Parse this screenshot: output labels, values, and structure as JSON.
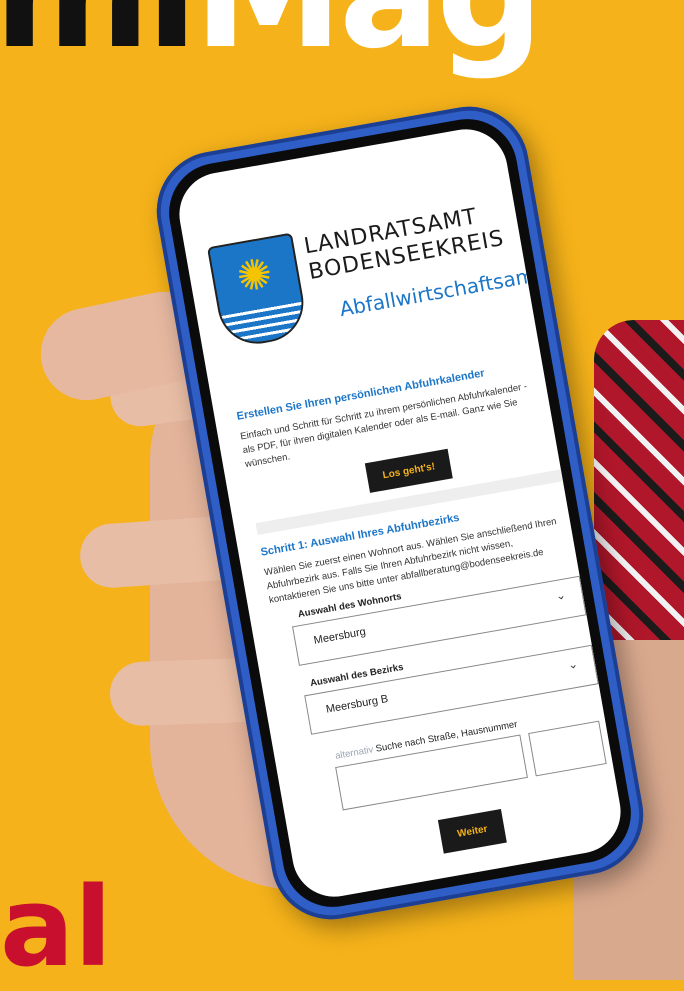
{
  "background": {
    "headline_fragment_black": "mi",
    "headline_fragment_white": "Mag",
    "bottom_fragment": "al",
    "bg_color": "#F5B21A",
    "accent_red": "#C8102E"
  },
  "phone": {
    "color": "#2f5fc6"
  },
  "site": {
    "org_line1": "LANDRATSAMT",
    "org_line2": "BODENSEEKREIS",
    "dept": "Abfallwirtschaftsamt",
    "crest_icon": "coat-of-arms-sun-icon",
    "primary_color": "#1c76c8"
  },
  "intro": {
    "title": "Erstellen Sie Ihren persönlichen Abfuhrkalender",
    "text": "Einfach und Schritt für Schritt zu ihrem persönlichen Abfuhrkalender - als PDF, für ihren digitalen Kalender oder als E-mail. Ganz wie Sie wünschen.",
    "button": "Los geht's!"
  },
  "step1": {
    "title": "Schritt 1: Auswahl Ihres Abfuhrbezirks",
    "text": "Wählen Sie zuerst einen Wohnort aus. Wählen Sie anschließend Ihren Abfuhrbezirk aus. Falls Sie Ihren Abfuhrbezirk nicht wissen, kontaktieren Sie uns bitte unter abfallberatung@bodenseekreis.de",
    "wohnort_label": "Auswahl des Wohnorts",
    "wohnort_value": "Meersburg",
    "bezirk_label": "Auswahl des Bezirks",
    "bezirk_value": "Meersburg B",
    "search_prefix": "alternativ",
    "search_label": "Suche nach Straße, Hausnummer",
    "next_button": "Weiter",
    "chevron_icon": "chevron-down-icon",
    "chat_icon": "chat-bot-icon"
  }
}
